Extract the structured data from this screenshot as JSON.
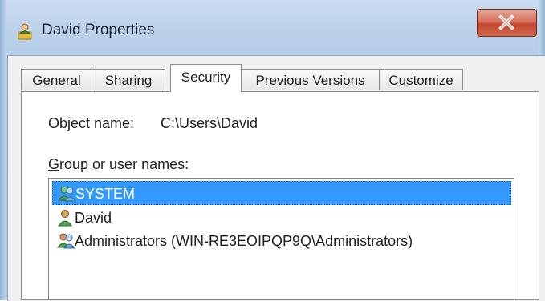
{
  "window": {
    "title": "David Properties",
    "icon": "folder-user-icon",
    "close_icon": "close-icon",
    "close_color": "#c7452f"
  },
  "tabs": [
    {
      "label": "General",
      "active": false
    },
    {
      "label": "Sharing",
      "active": false
    },
    {
      "label": "Security",
      "active": true
    },
    {
      "label": "Previous Versions",
      "active": false
    },
    {
      "label": "Customize",
      "active": false
    }
  ],
  "security": {
    "object_name_label": "Object name:",
    "object_name_value": "C:\\Users\\David",
    "group_label_accel": "G",
    "group_label_rest": "roup or user names:",
    "principals": [
      {
        "name": "SYSTEM",
        "icon": "group-users-icon",
        "selected": true
      },
      {
        "name": "David",
        "icon": "user-icon",
        "selected": false
      },
      {
        "name": "Administrators (WIN-RE3EOIPQP9Q\\Administrators)",
        "icon": "group-users-icon",
        "selected": false
      }
    ],
    "selection_color": "#3399ff"
  }
}
